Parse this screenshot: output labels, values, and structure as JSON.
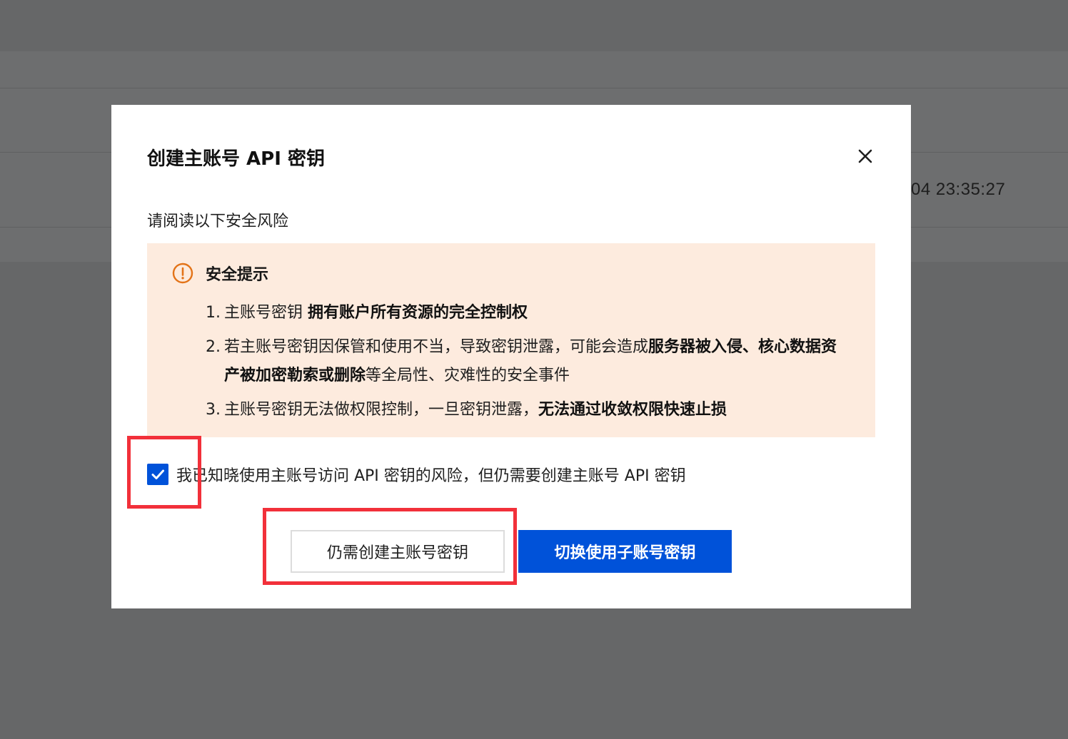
{
  "background": {
    "timestamp_fragment": "04 23:35:27"
  },
  "modal": {
    "title": "创建主账号 API 密钥",
    "close_icon": "close-icon",
    "intro": "请阅读以下安全风险",
    "notice": {
      "icon": "exclamation-circle-icon",
      "title": "安全提示",
      "items": [
        {
          "num": "1.",
          "segments": [
            {
              "text": "主账号密钥 ",
              "bold": false
            },
            {
              "text": "拥有账户所有资源的完全控制权",
              "bold": true
            }
          ]
        },
        {
          "num": "2.",
          "segments": [
            {
              "text": "若主账号密钥因保管和使用不当，导致密钥泄露，可能会造成",
              "bold": false
            },
            {
              "text": "服务器被入侵、核心数据资产被加密勒索或删除",
              "bold": true
            },
            {
              "text": "等全局性、灾难性的安全事件",
              "bold": false
            }
          ]
        },
        {
          "num": "3.",
          "segments": [
            {
              "text": "主账号密钥无法做权限控制，一旦密钥泄露，",
              "bold": false
            },
            {
              "text": "无法通过收敛权限快速止损",
              "bold": true
            }
          ]
        }
      ]
    },
    "ack": {
      "checked": true,
      "checkbox_icon": "checkmark-icon",
      "label": "我已知晓使用主账号访问 API 密钥的风险，但仍需要创建主账号 API 密钥"
    },
    "buttons": {
      "secondary_label": "仍需创建主账号密钥",
      "primary_label": "切换使用子账号密钥"
    }
  },
  "colors": {
    "primary": "#0052d9",
    "notice_bg": "#fdebde",
    "warning_icon": "#e37318",
    "highlight": "#f2303a",
    "overlay": "#666768"
  }
}
